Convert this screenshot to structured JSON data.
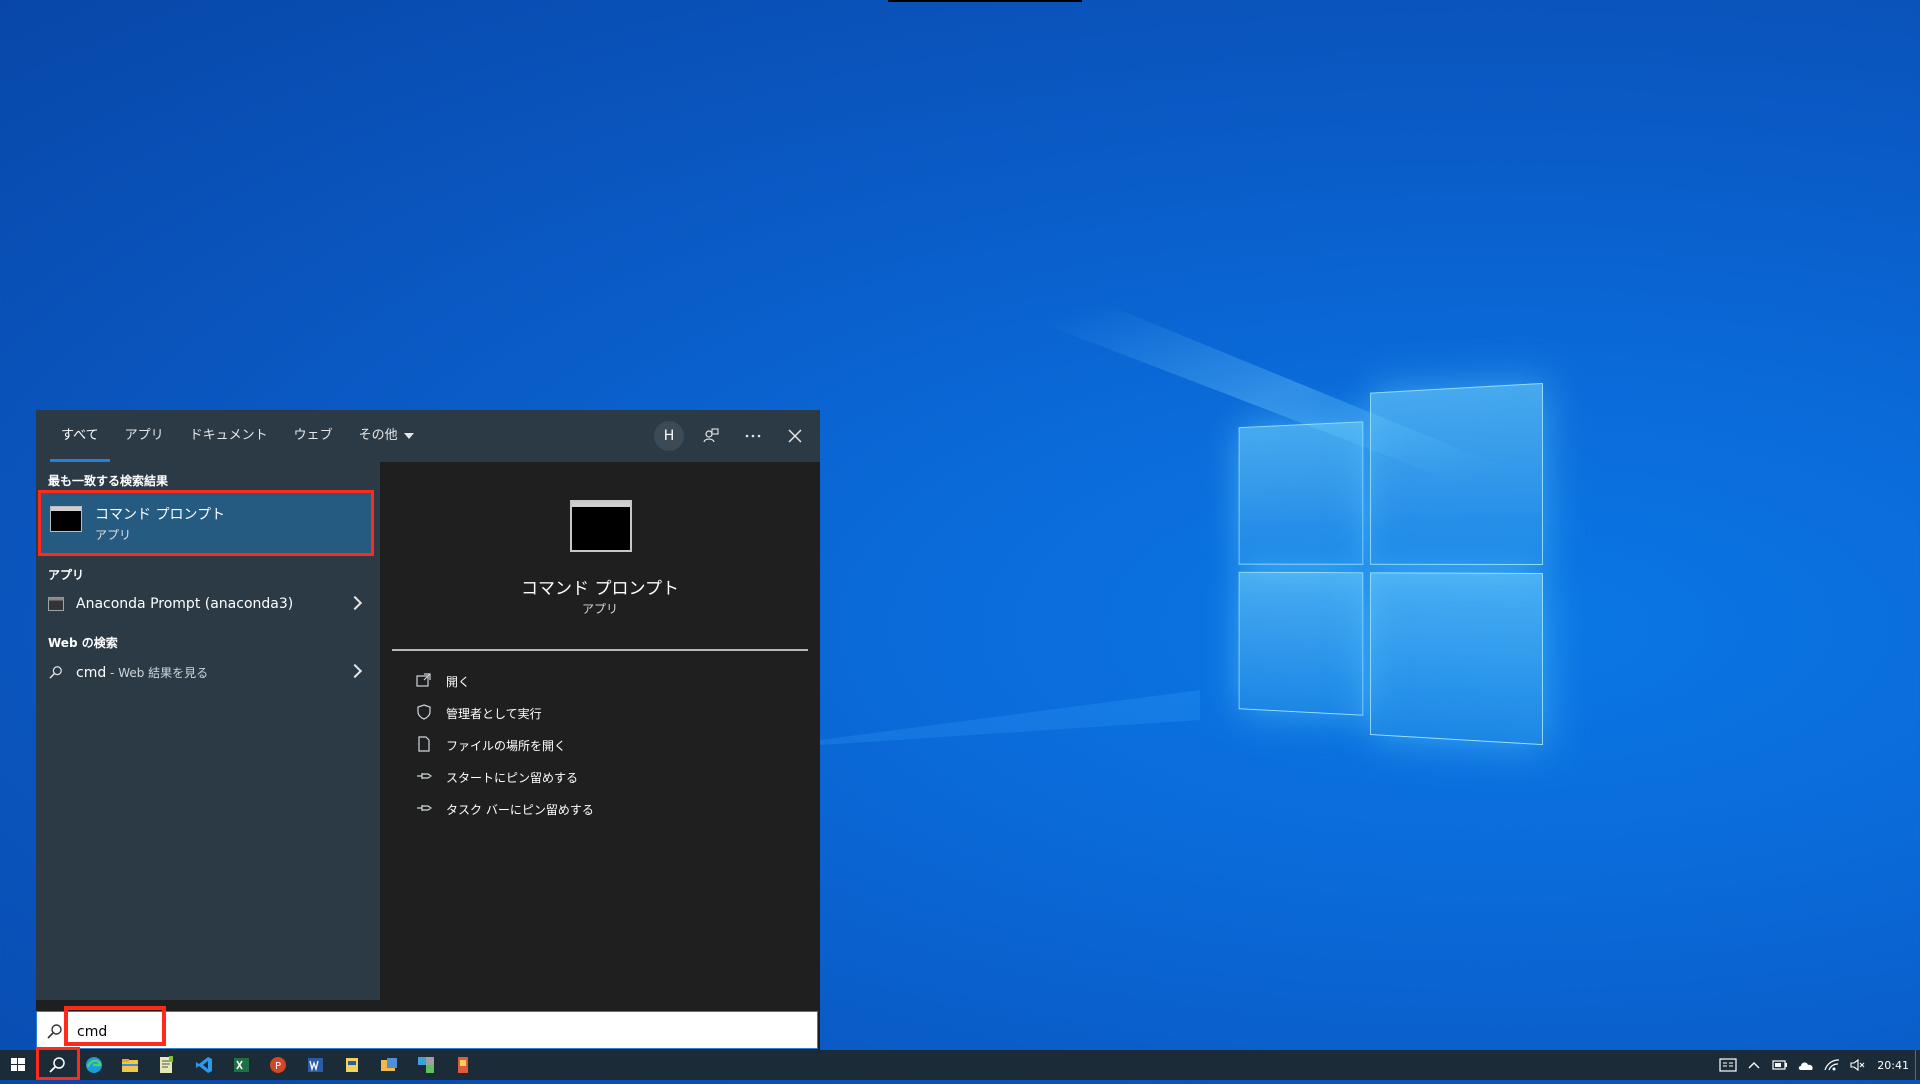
{
  "search_panel": {
    "tabs": [
      {
        "label": "すべて",
        "active": true
      },
      {
        "label": "アプリ"
      },
      {
        "label": "ドキュメント"
      },
      {
        "label": "ウェブ"
      },
      {
        "label": "その他"
      }
    ],
    "avatar_initial": "H",
    "best_match": {
      "header": "最も一致する検索結果",
      "title": "コマンド プロンプト",
      "subtitle": "アプリ"
    },
    "apps_section": {
      "header": "アプリ",
      "items": [
        {
          "label": "Anaconda Prompt (anaconda3)"
        }
      ]
    },
    "web_section": {
      "header": "Web の検索",
      "query": "cmd",
      "suffix": " - Web 結果を見る"
    },
    "preview": {
      "title": "コマンド プロンプト",
      "subtitle": "アプリ",
      "actions": [
        {
          "label": "開く",
          "icon": "open-icon"
        },
        {
          "label": "管理者として実行",
          "icon": "shield-icon"
        },
        {
          "label": "ファイルの場所を開く",
          "icon": "file-location-icon"
        },
        {
          "label": "スタートにピン留めする",
          "icon": "pin-icon"
        },
        {
          "label": "タスク バーにピン留めする",
          "icon": "pin-icon"
        }
      ]
    }
  },
  "search_box": {
    "value": "cmd"
  },
  "taskbar": {
    "apps": [
      "edge-icon",
      "file-explorer-icon",
      "notepad-icon",
      "vscode-icon",
      "excel-icon",
      "powerpoint-icon",
      "word-icon",
      "app-icon",
      "app-icon",
      "app-icon",
      "app-icon"
    ],
    "clock": "20:41"
  },
  "colors": {
    "accent": "#2a7fd4",
    "highlight": "#ff2a1a",
    "panel_bg": "#2b3a45",
    "preview_bg": "#1f1f1f",
    "taskbar": "#1c2b38"
  }
}
